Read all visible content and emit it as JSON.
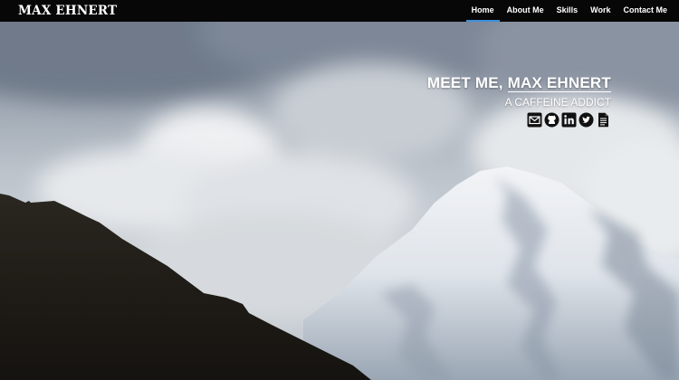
{
  "navbar": {
    "brand": "MAX EHNERT",
    "items": [
      {
        "label": "Home",
        "active": true
      },
      {
        "label": "About Me",
        "active": false
      },
      {
        "label": "Skills",
        "active": false
      },
      {
        "label": "Work",
        "active": false
      },
      {
        "label": "Contact Me",
        "active": false
      }
    ]
  },
  "hero": {
    "title_prefix": "MEET ME, ",
    "title_name": "MAX EHNERT",
    "subtitle": "A CAFFEINE ADDICT",
    "social": [
      {
        "icon": "email-icon"
      },
      {
        "icon": "github-icon"
      },
      {
        "icon": "linkedin-icon"
      },
      {
        "icon": "twitter-icon"
      },
      {
        "icon": "resume-document-icon"
      }
    ]
  },
  "colors": {
    "navbar_bg": "#070707",
    "active_underline": "#3d8fd8",
    "text": "#ffffff"
  }
}
